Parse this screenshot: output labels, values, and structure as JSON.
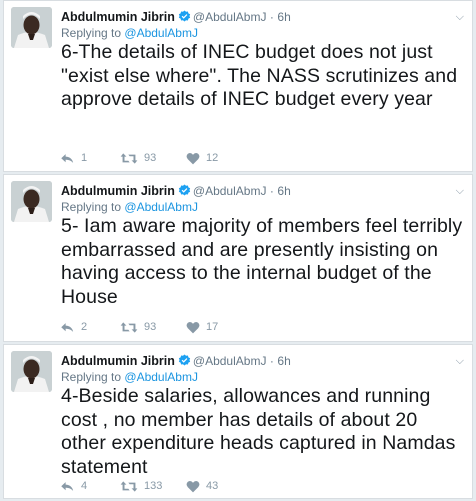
{
  "colors": {
    "background": "#e6ecf0",
    "link": "#1b95e0",
    "name": "#14171a",
    "muted": "#657786",
    "icon": "#8899a6"
  },
  "tweets": [
    {
      "author_name": "Abdulmumin Jibrin",
      "handle": "@AbdulAbmJ",
      "separator": "·",
      "time": "6h",
      "replying_to_label": "Replying to",
      "replying_to_user": "@AbdulAbmJ",
      "text": "6-The details of INEC budget does not just \"exist else where\". The NASS scrutinizes and approve details of INEC budget every year",
      "replies": "1",
      "retweets": "93",
      "likes": "12"
    },
    {
      "author_name": "Abdulmumin Jibrin",
      "handle": "@AbdulAbmJ",
      "separator": "·",
      "time": "6h",
      "replying_to_label": "Replying to",
      "replying_to_user": "@AbdulAbmJ",
      "text": "5- Iam aware majority of members feel terribly embarrassed and are presently insisting on having access to the internal budget of the House",
      "replies": "2",
      "retweets": "93",
      "likes": "17"
    },
    {
      "author_name": "Abdulmumin Jibrin",
      "handle": "@AbdulAbmJ",
      "separator": "·",
      "time": "6h",
      "replying_to_label": "Replying to",
      "replying_to_user": "@AbdulAbmJ",
      "text": "4-Beside salaries, allowances and running cost , no member has details of about 20 other expenditure heads captured in  Namdas statement",
      "replies": "4",
      "retweets": "133",
      "likes": "43"
    }
  ]
}
